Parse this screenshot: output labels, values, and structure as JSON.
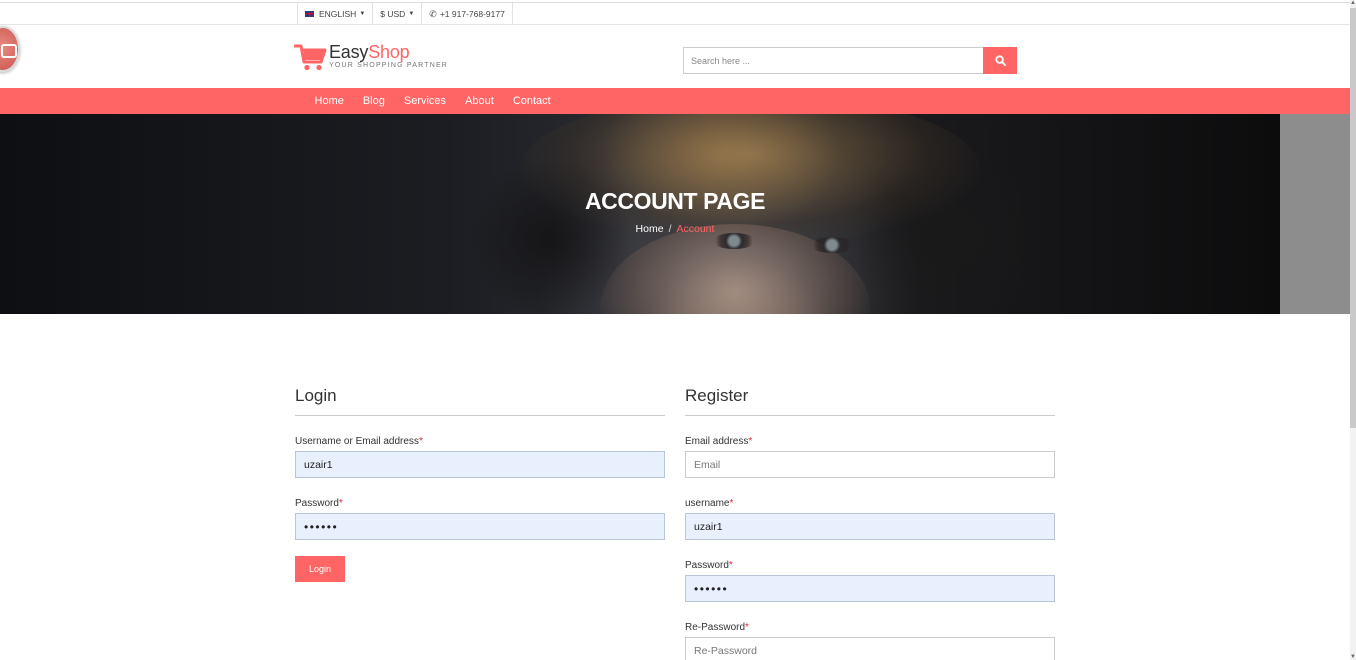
{
  "topbar": {
    "language": "ENGLISH",
    "currency": "$ USD",
    "phone": "+1 917-768-9177"
  },
  "header": {
    "logo_main": "Easy",
    "logo_accent": "Shop",
    "logo_tagline": "YOUR SHOPPING PARTNER",
    "search_placeholder": "Search here ..."
  },
  "nav": {
    "items": [
      "Home",
      "Blog",
      "Services",
      "About",
      "Contact"
    ]
  },
  "hero": {
    "title": "ACCOUNT PAGE",
    "breadcrumb_home": "Home",
    "breadcrumb_separator": "/",
    "breadcrumb_current": "Account"
  },
  "login": {
    "heading": "Login",
    "username_label": "Username or Email address",
    "username_value": "uzair1",
    "password_label": "Password",
    "password_value": "••••••",
    "button": "Login"
  },
  "register": {
    "heading": "Register",
    "email_label": "Email address",
    "email_placeholder": "Email",
    "username_label": "username",
    "username_value": "uzair1",
    "password_label": "Password",
    "password_value": "••••••",
    "repassword_label": "Re-Password",
    "repassword_placeholder": "Re-Password"
  },
  "required_mark": "*",
  "colors": {
    "accent": "#ff6565",
    "autofill": "#e8f0fe"
  }
}
